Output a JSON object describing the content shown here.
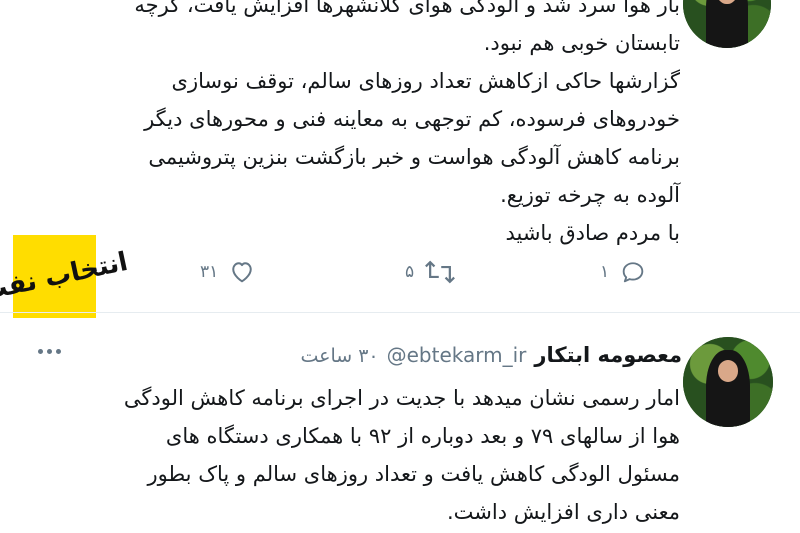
{
  "tweet1": {
    "lines": [
      "بار هوا سرد شد و آلودگی هوای کلانشهرها افزایش یافت، گرچه",
      "تابستان خوبی هم نبود.",
      "گزارشها حاکی ازکاهش تعداد روزهای سالم، توقف نوسازی",
      "خودروهای فرسوده، کم توجهی به معاینه فنی و محورهای دیگر",
      "برنامه کاهش آلودگی هواست و خبر بازگشت بنزین پتروشیمی",
      "آلوده به چرخه توزیع.",
      "با مردم صادق باشید"
    ],
    "actions": {
      "reply_count": "۱",
      "retweet_count": "۵",
      "like_count": "۳۱"
    }
  },
  "logo": {
    "text": "انتخاب نفت"
  },
  "tweet2": {
    "author_name": "معصومه ابتکار",
    "author_handle": "@ebtekarm_ir",
    "time": "۳۰ ساعت",
    "lines": [
      "امار رسمی نشان میدهد با جدیت در اجرای برنامه کاهش الودگی",
      "هوا از سالهای ۷۹ و بعد دوباره از ۹۲ با همکاری دستگاه های",
      "مسئول الودگی کاهش یافت و تعداد روزهای سالم و پاک بطور",
      "معنی داری افزایش داشت."
    ]
  },
  "colors": {
    "text": "#14171a",
    "muted": "#657786",
    "divider": "#e6ecf0",
    "logo_bg": "#ffdd00"
  }
}
